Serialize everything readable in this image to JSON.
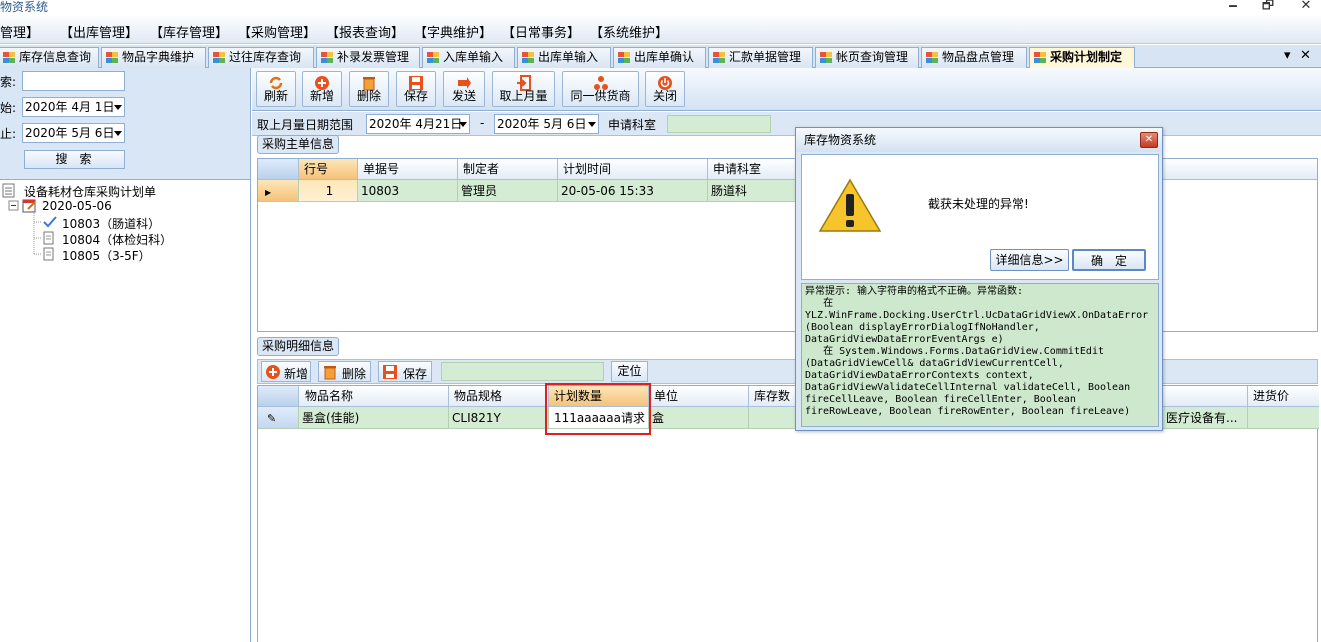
{
  "window": {
    "title": "物资系统",
    "minimize": "🗕",
    "restore": "🗗",
    "close": "✕"
  },
  "menu": [
    "管理】",
    "【出库管理】",
    "【库存管理】",
    "【采购管理】",
    "【报表查询】",
    "【字典维护】",
    "【日常事务】",
    "【系统维护】"
  ],
  "tabs": [
    "库存信息查询",
    "物品字典维护",
    "过往库存查询",
    "补录发票管理",
    "入库单输入",
    "出库单输入",
    "出库单确认",
    "汇款单据管理",
    "帐页查询管理",
    "物品盘点管理",
    "采购计划制定"
  ],
  "tab_controls": {
    "dropdown": "▾",
    "close": "✕"
  },
  "left": {
    "search_label": "索:",
    "search_value": "",
    "start_label": "始:",
    "start_date": "2020年 4月 1日",
    "end_label": "止:",
    "end_date": "2020年 5月 6日",
    "search_button": "搜索",
    "tree": {
      "root": "设备耗材仓库采购计划单",
      "date": "2020-05-06",
      "items": [
        "10803（肠道科）",
        "10804（体检妇科）",
        "10805（3-5F）"
      ]
    }
  },
  "toolbar": {
    "buttons": [
      "刷新",
      "新增",
      "删除",
      "保存",
      "发送",
      "取上月量",
      "同一供货商",
      "关闭"
    ]
  },
  "range": {
    "label": "取上月量日期范围",
    "from": "2020年 4月21日",
    "dash": "-",
    "to": "2020年 5月 6日",
    "dept_label": "申请科室",
    "dept_value": ""
  },
  "master": {
    "group_label": "采购主单信息",
    "columns": [
      "行号",
      "单据号",
      "制定者",
      "计划时间",
      "申请科室"
    ],
    "rows": [
      {
        "row_no": "1",
        "doc_no": "10803",
        "maker": "管理员",
        "time": "20-05-06 15:33",
        "dept": "肠道科"
      }
    ]
  },
  "detail": {
    "group_label": "采购明细信息",
    "add": "新增",
    "delete": "删除",
    "save": "保存",
    "locate_value": "",
    "locate": "定位",
    "columns": [
      "物品名称",
      "物品规格",
      "计划数量",
      "单位",
      "库存数",
      "进货价"
    ],
    "rows": [
      {
        "name": "墨盒(佳能)",
        "spec": "CLI821Y",
        "qty": "111aaaaaa请求",
        "unit": "盒",
        "stock": "",
        "supplier": "医疗设备有...",
        "price": ""
      }
    ]
  },
  "dialog": {
    "title": "库存物资系统",
    "message": "截获未处理的异常!",
    "details_button": "详细信息>>",
    "ok_button": "确　定",
    "detail_text": "异常提示: 输入字符串的格式不正确。异常函数:\n   在\nYLZ.WinFrame.Docking.UserCtrl.UcDataGridViewX.OnDataError\n(Boolean displayErrorDialogIfNoHandler,\nDataGridViewDataErrorEventArgs e)\n   在 System.Windows.Forms.DataGridView.CommitEdit\n(DataGridViewCell& dataGridViewCurrentCell,\nDataGridViewDataErrorContexts context,\nDataGridViewValidateCellInternal validateCell, Boolean\nfireCellLeave, Boolean fireCellEnter, Boolean\nfireRowLeave, Boolean fireRowEnter, Boolean fireLeave)"
  },
  "colors": {
    "accent": "#d9e6f5",
    "row_green": "#d4ebd4",
    "highlight": "#e02020",
    "warning": "#f5c52b"
  }
}
